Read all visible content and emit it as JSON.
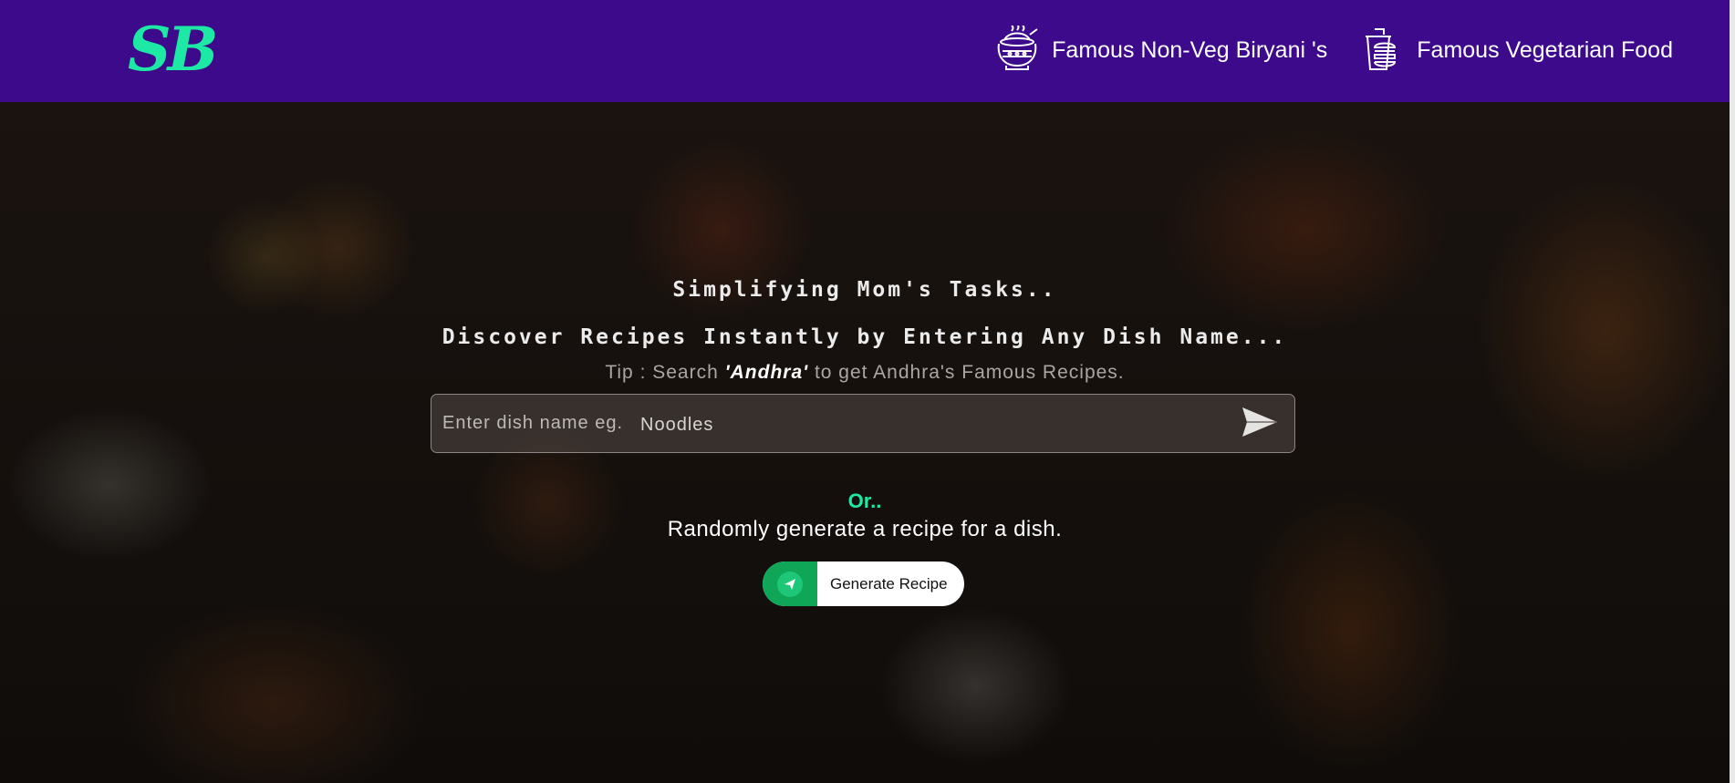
{
  "header": {
    "logo_text": "SB",
    "links": [
      {
        "label": "Famous Non-Veg Biryani 's",
        "icon": "biryani-pot-icon"
      },
      {
        "label": "Famous Vegetarian Food",
        "icon": "fast-food-icon"
      }
    ]
  },
  "hero": {
    "tagline": "Simplifying Mom's Tasks..",
    "headline": "Discover Recipes Instantly by Entering Any Dish Name...",
    "tip_prefix": "Tip : Search ",
    "tip_keyword": "'Andhra'",
    "tip_suffix": " to get Andhra's Famous Recipes.",
    "search": {
      "placeholder": "Enter dish name eg.",
      "value": "Noodles",
      "submit_icon": "send-arrow-icon"
    },
    "or_text": "Or..",
    "random_text": "Randomly generate a recipe for a dish.",
    "generate_button": {
      "label": "Generate Recipe",
      "icon": "paper-plane-icon"
    }
  },
  "colors": {
    "navbar": "#3d0a8b",
    "accent": "#1de9a5",
    "button_green": "#0fa658"
  }
}
